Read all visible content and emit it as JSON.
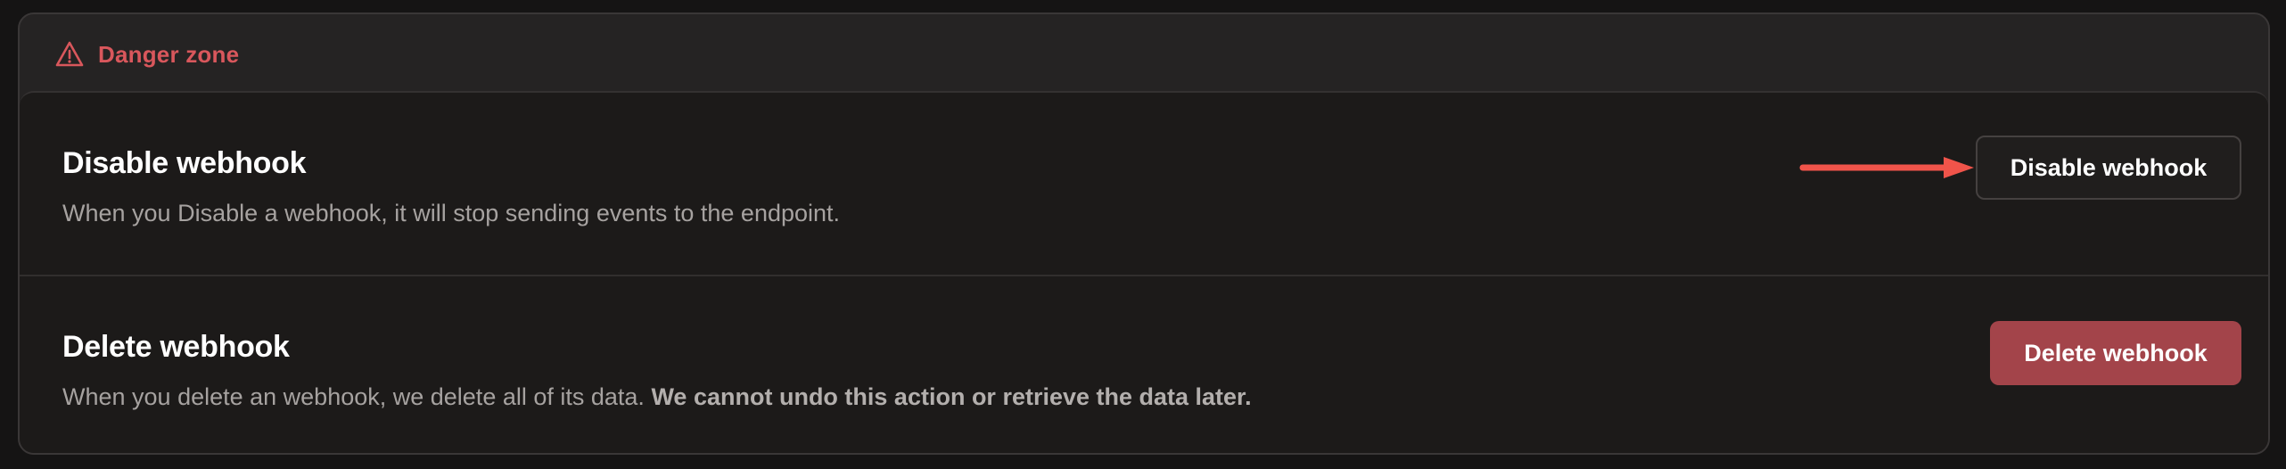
{
  "danger_zone": {
    "title": "Danger zone",
    "icon": "warning-triangle-icon",
    "accent_color": "#d9575c"
  },
  "disable": {
    "title": "Disable webhook",
    "description": "When you Disable a webhook, it will stop sending events to the endpoint.",
    "button_label": "Disable webhook"
  },
  "delete": {
    "title": "Delete webhook",
    "description": "When you delete an webhook, we delete all of its data.",
    "description_bold": "We cannot undo this action or retrieve the data later.",
    "button_label": "Delete webhook",
    "button_color": "#a3444a"
  },
  "annotation": {
    "arrow_color": "#f0544a"
  }
}
